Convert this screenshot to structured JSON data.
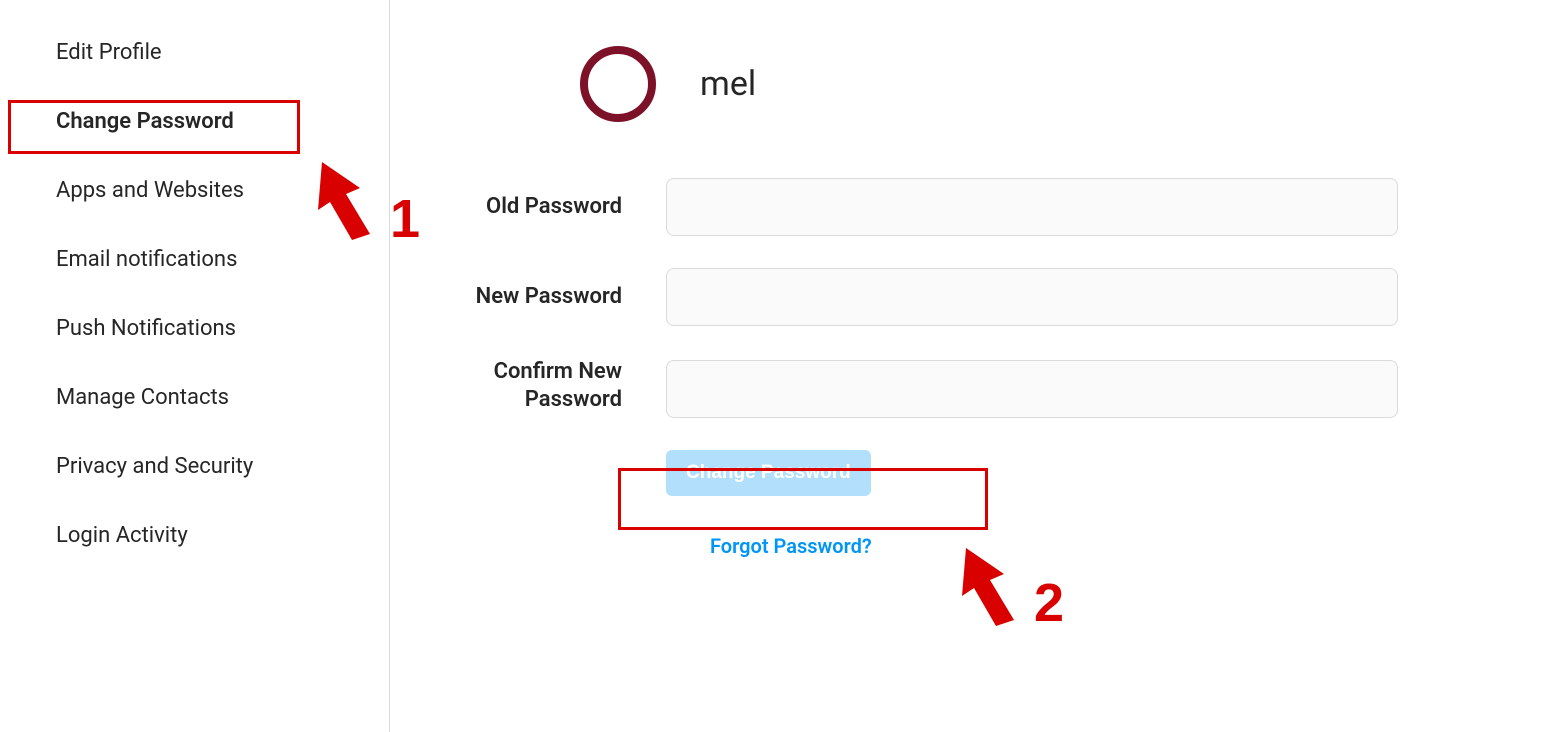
{
  "sidebar": {
    "items": [
      {
        "label": "Edit Profile"
      },
      {
        "label": "Change Password"
      },
      {
        "label": "Apps and Websites"
      },
      {
        "label": "Email notifications"
      },
      {
        "label": "Push Notifications"
      },
      {
        "label": "Manage Contacts"
      },
      {
        "label": "Privacy and Security"
      },
      {
        "label": "Login Activity"
      }
    ],
    "active_index": 1
  },
  "profile": {
    "username": "mel"
  },
  "form": {
    "old_password_label": "Old Password",
    "new_password_label": "New Password",
    "confirm_password_label": "Confirm New Password",
    "old_password_value": "",
    "new_password_value": "",
    "confirm_password_value": ""
  },
  "actions": {
    "change_button": "Change Password",
    "forgot_link": "Forgot Password?"
  },
  "annotations": {
    "label1": "1",
    "label2": "2"
  }
}
